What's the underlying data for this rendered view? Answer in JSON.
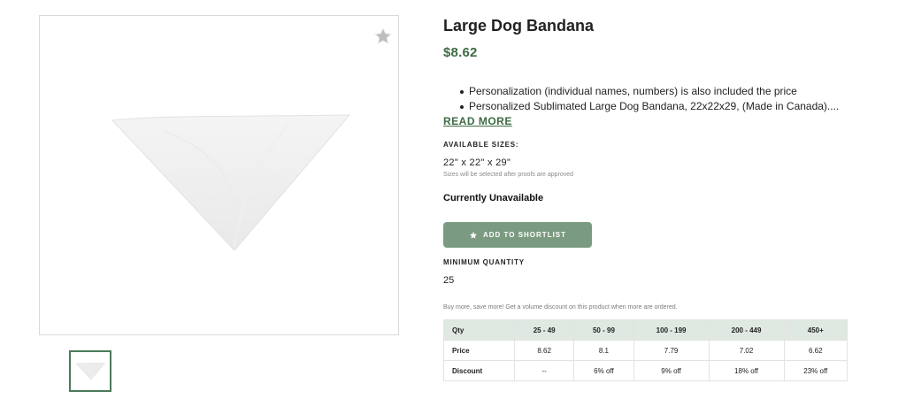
{
  "product": {
    "title": "Large Dog Bandana",
    "price": "$8.62",
    "description_bullets": [
      "Personalization (individual names, numbers) is also included the price",
      "Personalized Sublimated Large Dog Bandana, 22x22x29, (Made in Canada)...."
    ],
    "read_more_label": "READ MORE",
    "sizes": {
      "label": "AVAILABLE SIZES:",
      "value": "22\" x 22\" x 29\"",
      "note": "Sizes will be selected after proofs are approved"
    },
    "availability": "Currently Unavailable",
    "shortlist_button": {
      "label": "ADD TO SHORTLIST",
      "icon": "star-icon"
    },
    "minimum_quantity": {
      "label": "MINIMUM QUANTITY",
      "value": "25"
    },
    "volume_note": "Buy more, save more! Get a volume discount on this product when more are ordered."
  },
  "gallery": {
    "favorite_icon": "star-icon",
    "thumbnail_count": 1
  },
  "pricing_table": {
    "headers": [
      "Qty",
      "25 - 49",
      "50 - 99",
      "100 - 199",
      "200 - 449",
      "450+"
    ],
    "rows": [
      [
        "Price",
        "8.62",
        "8.1",
        "7.79",
        "7.02",
        "6.62"
      ],
      [
        "Discount",
        "--",
        "6% off",
        "9% off",
        "18% off",
        "23% off"
      ]
    ]
  },
  "colors": {
    "accent_green": "#3e6b45",
    "button_green": "#7b9b80",
    "table_header_bg": "#dfe8e1",
    "thumb_border": "#4d7a5a"
  }
}
